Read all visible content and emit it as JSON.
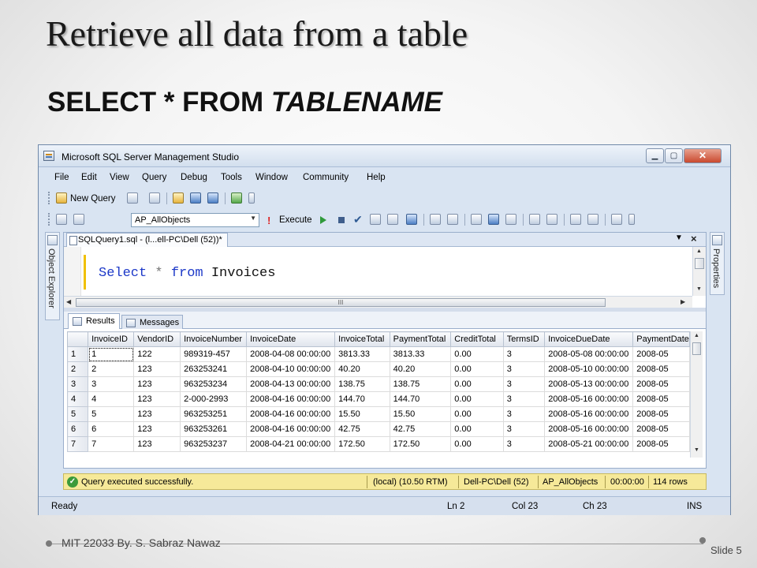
{
  "slide": {
    "title": "Retrieve all data from a table",
    "subtitle_plain": "SELECT * FROM ",
    "subtitle_italic": "TABLENAME",
    "footer_left": "MIT 22033 By. S. Sabraz Nawaz",
    "footer_right": "Slide 5"
  },
  "window": {
    "title": "Microsoft SQL Server Management Studio",
    "min_label": "▁",
    "max_label": "▢",
    "close_label": "✕"
  },
  "menu": [
    "File",
    "Edit",
    "View",
    "Query",
    "Debug",
    "Tools",
    "Window",
    "Community",
    "Help"
  ],
  "toolbar": {
    "new_query": "New Query",
    "database": "AP_AllObjects",
    "execute": "Execute"
  },
  "side": {
    "left_panel": "Object Explorer",
    "right_panel": "Properties"
  },
  "document": {
    "tab_title": "SQLQuery1.sql - (l...ell-PC\\Dell (52))*",
    "code": {
      "kw_select": "Select",
      "star": "*",
      "kw_from": "from",
      "table": "Invoices"
    },
    "scroll_grip": "III"
  },
  "results": {
    "tab_results": "Results",
    "tab_messages": "Messages",
    "columns": [
      "",
      "InvoiceID",
      "VendorID",
      "InvoiceNumber",
      "InvoiceDate",
      "InvoiceTotal",
      "PaymentTotal",
      "CreditTotal",
      "TermsID",
      "InvoiceDueDate",
      "PaymentDate"
    ],
    "rows": [
      [
        "1",
        "1",
        "122",
        "989319-457",
        "2008-04-08 00:00:00",
        "3813.33",
        "3813.33",
        "0.00",
        "3",
        "2008-05-08 00:00:00",
        "2008-05"
      ],
      [
        "2",
        "2",
        "123",
        "263253241",
        "2008-04-10 00:00:00",
        "40.20",
        "40.20",
        "0.00",
        "3",
        "2008-05-10 00:00:00",
        "2008-05"
      ],
      [
        "3",
        "3",
        "123",
        "963253234",
        "2008-04-13 00:00:00",
        "138.75",
        "138.75",
        "0.00",
        "3",
        "2008-05-13 00:00:00",
        "2008-05"
      ],
      [
        "4",
        "4",
        "123",
        "2-000-2993",
        "2008-04-16 00:00:00",
        "144.70",
        "144.70",
        "0.00",
        "3",
        "2008-05-16 00:00:00",
        "2008-05"
      ],
      [
        "5",
        "5",
        "123",
        "963253251",
        "2008-04-16 00:00:00",
        "15.50",
        "15.50",
        "0.00",
        "3",
        "2008-05-16 00:00:00",
        "2008-05"
      ],
      [
        "6",
        "6",
        "123",
        "963253261",
        "2008-04-16 00:00:00",
        "42.75",
        "42.75",
        "0.00",
        "3",
        "2008-05-16 00:00:00",
        "2008-05"
      ],
      [
        "7",
        "7",
        "123",
        "963253237",
        "2008-04-21 00:00:00",
        "172.50",
        "172.50",
        "0.00",
        "3",
        "2008-05-21 00:00:00",
        "2008-05"
      ]
    ]
  },
  "query_status": {
    "message": "Query executed successfully.",
    "server": "(local) (10.50 RTM)",
    "user": "Dell-PC\\Dell (52)",
    "database": "AP_AllObjects",
    "elapsed": "00:00:00",
    "rows": "114 rows"
  },
  "app_status": {
    "state": "Ready",
    "line": "Ln 2",
    "col": "Col 23",
    "ch": "Ch 23",
    "mode": "INS"
  },
  "colors": {
    "accent": "#1c38c8",
    "status_bar": "#f6e999",
    "window_frame": "#d9e4f2"
  }
}
